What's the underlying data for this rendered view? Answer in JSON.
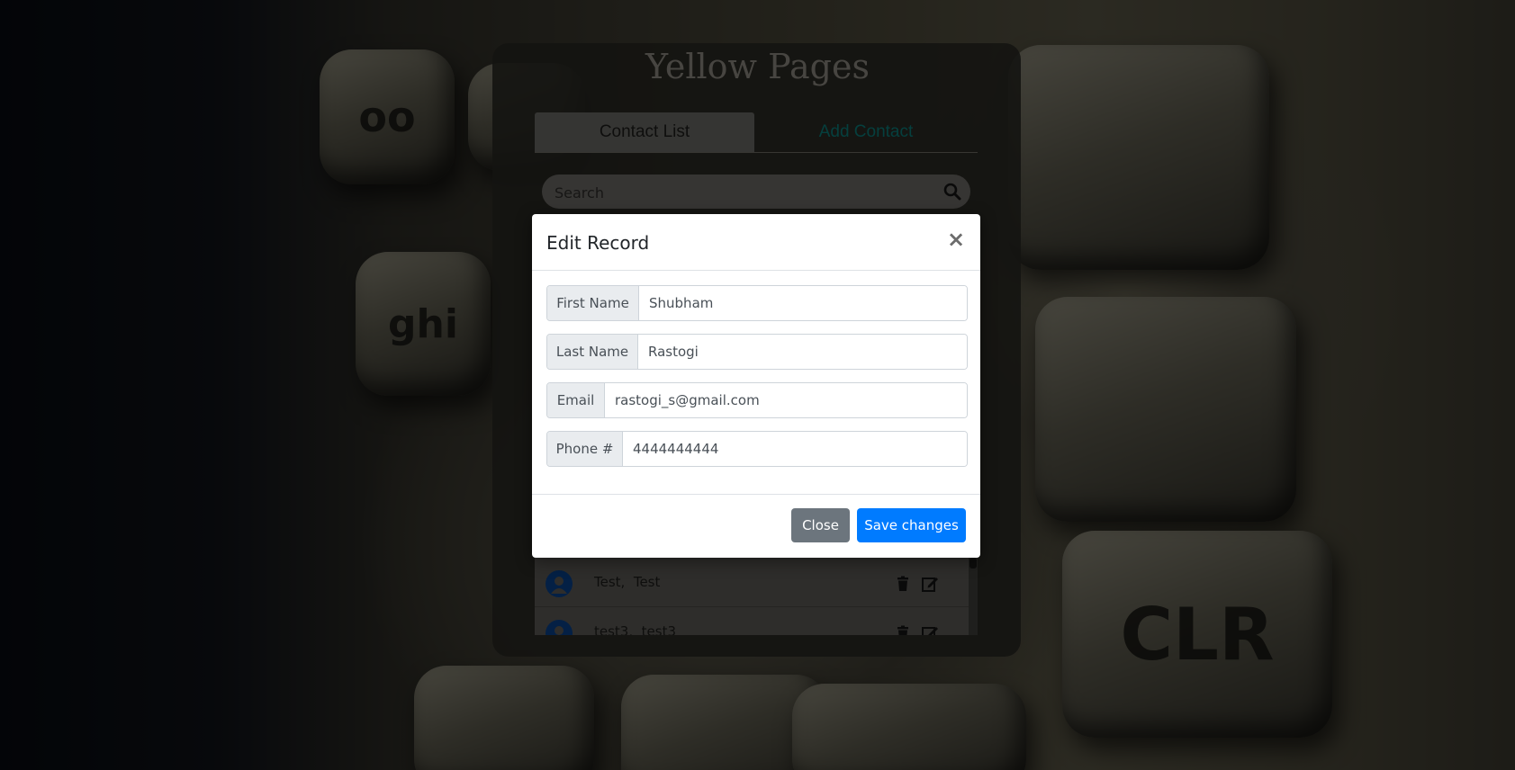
{
  "app": {
    "title": "Yellow Pages"
  },
  "tabs": [
    {
      "label": "Contact List",
      "active": true
    },
    {
      "label": "Add Contact",
      "active": false
    }
  ],
  "search": {
    "placeholder": "Search",
    "icon": "search-icon"
  },
  "contacts": [
    {
      "name": "Test,  Test",
      "icon": "user-icon"
    },
    {
      "name": "test3,  test3",
      "icon": "user-icon"
    }
  ],
  "row_actions": {
    "delete_icon": "trash-icon",
    "edit_icon": "edit-icon"
  },
  "modal": {
    "title": "Edit Record",
    "close_glyph": "×",
    "fields": {
      "first_name": {
        "label": "First Name",
        "value": "Shubham"
      },
      "last_name": {
        "label": "Last Name",
        "value": "Rastogi"
      },
      "email": {
        "label": "Email",
        "value": "rastogi_s@gmail.com"
      },
      "phone": {
        "label": "Phone #",
        "value": "4444444444"
      }
    },
    "buttons": {
      "close_label": "Close",
      "save_label": "Save changes"
    }
  },
  "colors": {
    "primary": "#007bff",
    "secondary": "#6c757d",
    "tab_accent": "#0b7f7c",
    "avatar": "#08408a"
  }
}
